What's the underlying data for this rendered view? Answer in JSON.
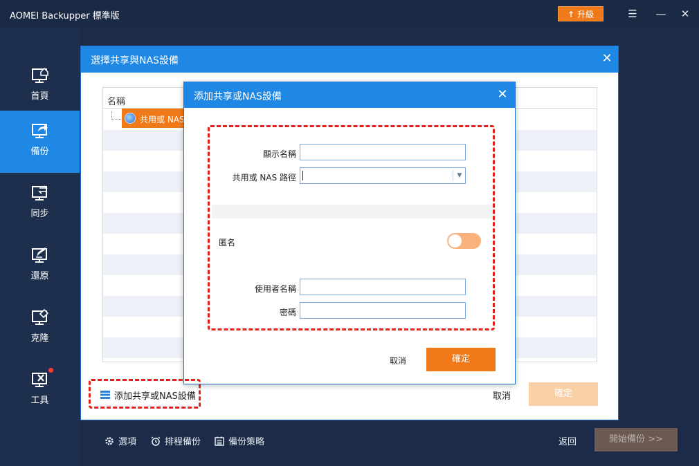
{
  "app": {
    "title": "AOMEI Backupper 標準版",
    "upgrade_label": "升級"
  },
  "window_controls": {
    "menu_icon": "menu-icon",
    "minimize_icon": "minimize-icon",
    "close_icon": "close-icon"
  },
  "sidebar": {
    "items": [
      {
        "label": "首頁",
        "icon": "home-monitor-icon",
        "active": false
      },
      {
        "label": "備份",
        "icon": "backup-monitor-icon",
        "active": true
      },
      {
        "label": "同步",
        "icon": "sync-monitor-icon",
        "active": false
      },
      {
        "label": "還原",
        "icon": "restore-monitor-icon",
        "active": false
      },
      {
        "label": "克隆",
        "icon": "clone-monitor-icon",
        "active": false
      },
      {
        "label": "工具",
        "icon": "tools-monitor-icon",
        "active": false
      }
    ]
  },
  "share_dialog": {
    "title": "選擇共享與NAS設備",
    "tree_header": "名稱",
    "tree_selected_item": "共用或 NAS",
    "add_share_label": "添加共享或NAS設備",
    "cancel_label": "取消",
    "ok_label": "確定"
  },
  "add_dialog": {
    "title": "添加共享或NAS設備",
    "display_name_label": "顯示名稱",
    "display_name_value": "",
    "path_label": "共用或 NAS 路徑",
    "path_value": "",
    "anonymous_label": "匿名",
    "anonymous_on": false,
    "username_label": "使用者名稱",
    "username_value": "",
    "password_label": "密碼",
    "password_value": "",
    "cancel_label": "取消",
    "ok_label": "確定"
  },
  "bottom_bar": {
    "options_label": "選項",
    "schedule_label": "排程備份",
    "scheme_label": "備份策略",
    "back_label": "返回",
    "start_label": "開始備份 >>"
  },
  "colors": {
    "accent_blue": "#1f88e5",
    "accent_orange": "#f07a1a",
    "annotation_red": "#e0211b"
  }
}
